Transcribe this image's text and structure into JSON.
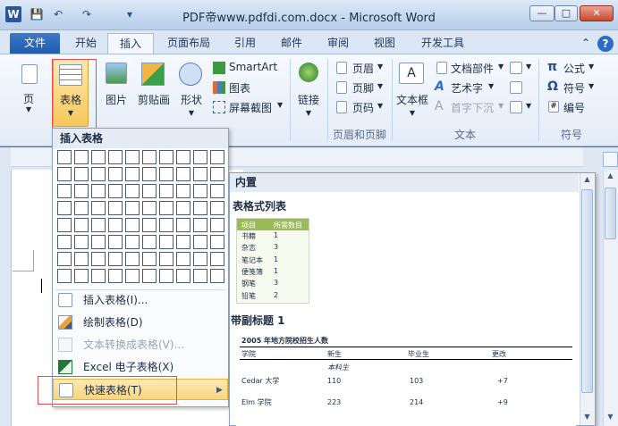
{
  "window": {
    "title": "PDF帝www.pdfdi.com.docx - Microsoft Word",
    "app_icon": "W"
  },
  "tabs": [
    "文件",
    "开始",
    "插入",
    "页面布局",
    "引用",
    "邮件",
    "审阅",
    "视图",
    "开发工具"
  ],
  "active_tab": "插入",
  "ribbon": {
    "page_btn": "页",
    "table_btn": "表格",
    "picture_btn": "图片",
    "clipart_btn": "剪贴画",
    "shapes_btn": "形状",
    "smartart": "SmartArt",
    "chart": "图表",
    "screenshot": "屏幕截图",
    "link_btn": "链接",
    "header": "页眉",
    "footer": "页脚",
    "page_number": "页码",
    "header_footer_group": "页眉和页脚",
    "textbox": "文本框",
    "quickparts": "文档部件",
    "wordart": "艺术字",
    "dropcap": "首字下沉",
    "text_group": "文本",
    "equation": "公式",
    "symbol": "符号",
    "number": "编号",
    "symbols_group": "符号"
  },
  "table_menu": {
    "header": "插入表格",
    "items": [
      {
        "label": "插入表格(I)...",
        "disabled": false
      },
      {
        "label": "绘制表格(D)",
        "disabled": false
      },
      {
        "label": "文本转换成表格(V)...",
        "disabled": true
      },
      {
        "label": "Excel 电子表格(X)",
        "disabled": false
      },
      {
        "label": "快速表格(T)",
        "disabled": false
      }
    ]
  },
  "gallery": {
    "header": "内置",
    "section1": "表格式列表",
    "list_headers": [
      "项目",
      "所需数目"
    ],
    "list_rows": [
      [
        "书籍",
        "1"
      ],
      [
        "杂志",
        "3"
      ],
      [
        "笔记本",
        "1"
      ],
      [
        "便笺簿",
        "1"
      ],
      [
        "钢笔",
        "3"
      ],
      [
        "铅笔",
        "2"
      ]
    ],
    "section2": "带副标题 1",
    "t2_title": "2005 年地方院校招生人数",
    "t2_headers": [
      "学院",
      "新生",
      "毕业生",
      "更改"
    ],
    "t2_sub": "本科生",
    "t2_rows": [
      [
        "Cedar 大学",
        "110",
        "103",
        "+7"
      ],
      [
        "Elm 学院",
        "223",
        "214",
        "+9"
      ]
    ]
  }
}
